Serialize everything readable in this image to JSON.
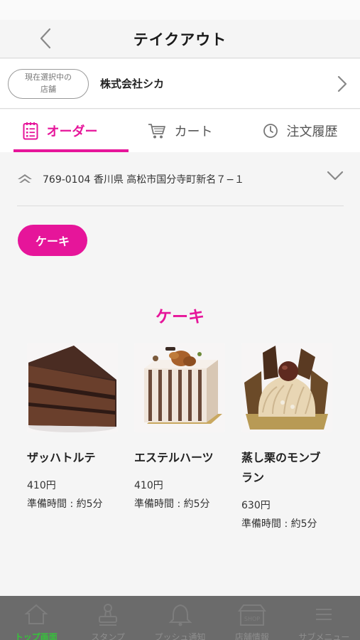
{
  "header": {
    "title": "テイクアウト"
  },
  "store": {
    "badge_line1": "現在選択中の",
    "badge_line2": "店舗",
    "name": "株式会社シカ"
  },
  "tabs": [
    {
      "label": "オーダー",
      "icon": "order-list-icon",
      "active": true
    },
    {
      "label": "カート",
      "icon": "cart-icon",
      "active": false
    },
    {
      "label": "注文履歴",
      "icon": "clock-icon",
      "active": false
    }
  ],
  "address": {
    "text": "769-0104 香川県 高松市国分寺町新名７−１"
  },
  "category_pill": "ケーキ",
  "section": {
    "title": "ケーキ"
  },
  "products": [
    {
      "name": "ザッハトルテ",
      "price": "410円",
      "prep": "準備時間 : 約5分"
    },
    {
      "name": "エステルハーツ",
      "price": "410円",
      "prep": "準備時間 : 約5分"
    },
    {
      "name_line1": "蒸し栗のモンブ",
      "name_line2": "ラン",
      "price": "630円",
      "prep": "準備時間 : 約5分"
    }
  ],
  "bottom_nav": [
    {
      "label": "トップ画面",
      "icon": "home-icon",
      "active": true
    },
    {
      "label": "スタンプ",
      "icon": "stamp-icon",
      "active": false
    },
    {
      "label": "プッシュ通知",
      "icon": "bell-icon",
      "active": false
    },
    {
      "label": "店舗情報",
      "icon": "shop-icon",
      "icon_text": "SHOP",
      "active": false
    },
    {
      "label": "サブメニュー",
      "icon": "menu-icon",
      "active": false
    }
  ],
  "colors": {
    "accent": "#e6159a",
    "active_nav": "#35c43a",
    "bottom_bar": "#6b6b6b"
  }
}
